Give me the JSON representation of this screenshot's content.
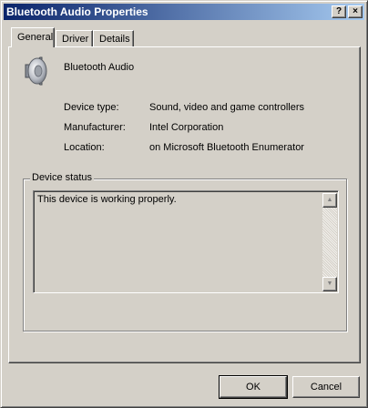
{
  "window": {
    "title": "Bluetooth Audio Properties",
    "help_icon": "help-icon",
    "close_icon": "close-icon",
    "help_glyph": "?",
    "close_glyph": "×"
  },
  "tabs": [
    {
      "label": "General",
      "active": true
    },
    {
      "label": "Driver",
      "active": false
    },
    {
      "label": "Details",
      "active": false
    }
  ],
  "device": {
    "icon": "speaker-icon",
    "name": "Bluetooth Audio",
    "properties": [
      {
        "label": "Device type:",
        "value": "Sound, video and game controllers"
      },
      {
        "label": "Manufacturer:",
        "value": "Intel Corporation"
      },
      {
        "label": "Location:",
        "value": "on Microsoft Bluetooth Enumerator"
      }
    ]
  },
  "status": {
    "group_label": "Device status",
    "text": "This device is working properly."
  },
  "buttons": {
    "ok": "OK",
    "cancel": "Cancel"
  },
  "colors": {
    "title_gradient_start": "#0a246a",
    "title_gradient_end": "#a6caf0",
    "face": "#d4d0c8"
  }
}
